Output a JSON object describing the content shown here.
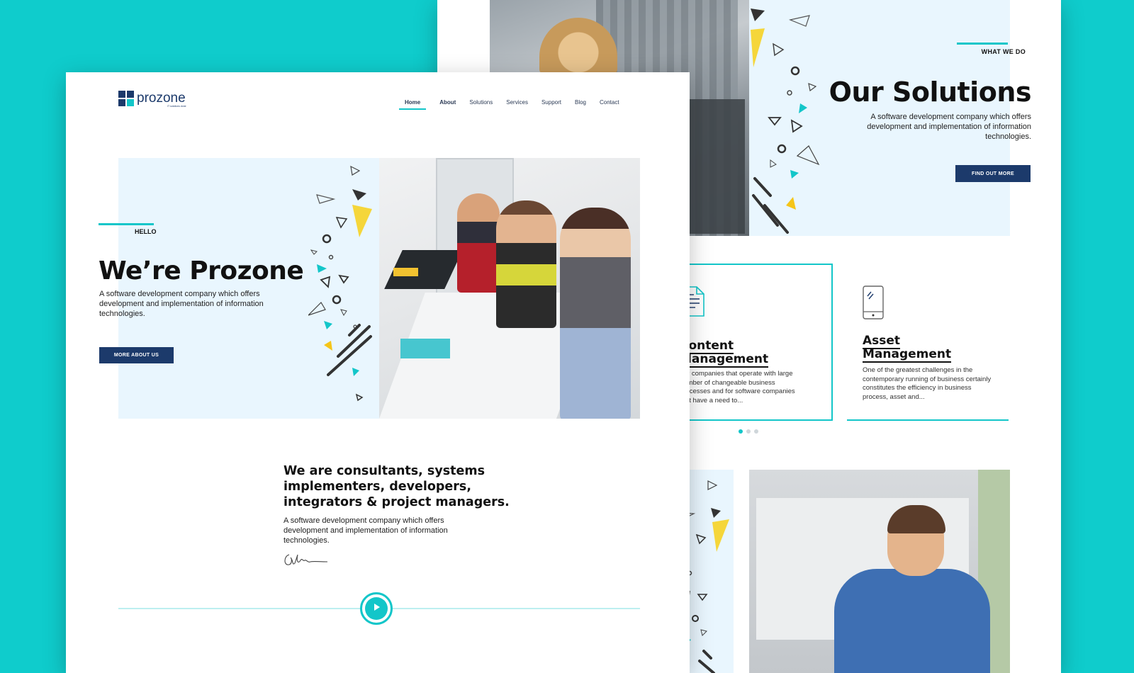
{
  "colors": {
    "background": "#0fcccc",
    "accent": "#13c6c9",
    "navy": "#1c3a6b",
    "panel": "#e9f6fe",
    "yellow": "#f5c518"
  },
  "front": {
    "logo": {
      "text": "prozone",
      "tagline": "IT solutions done"
    },
    "nav": [
      "Home",
      "About",
      "Solutions",
      "Services",
      "Support",
      "Blog",
      "Contact"
    ],
    "nav_active": "Home",
    "hero": {
      "label": "HELLO",
      "title": "We’re Prozone",
      "description": "A software development company which offers development and implementation of information technologies.",
      "cta": "MORE ABOUT US"
    },
    "about": {
      "heading": "We are consultants, systems implementers, developers, integrators & project managers.",
      "description": "A software development company which offers development and implementation of information technologies."
    },
    "icons": {
      "play": "play-icon",
      "signature": "signature-icon",
      "logo": "logo-mark-icon"
    }
  },
  "back": {
    "section_label": "WHAT WE DO",
    "title": "Our Solutions",
    "description": "A software development company which offers development and implementation of information technologies.",
    "cta": "FIND OUT MORE",
    "cards": [
      {
        "icon": "document-icon",
        "title_line1": "Content",
        "title_line2": "Management",
        "text": "For companies that operate with large number of changeable business processes and for software companies that have a need to..."
      },
      {
        "icon": "mobile-phone-icon",
        "title_line1": "Asset",
        "title_line2": "Management",
        "text": "One of the greatest challenges in the contemporary running of business certainly constitutes the efficiency in business process, asset and..."
      }
    ],
    "carousel": {
      "pages": 3,
      "active": 1
    }
  }
}
